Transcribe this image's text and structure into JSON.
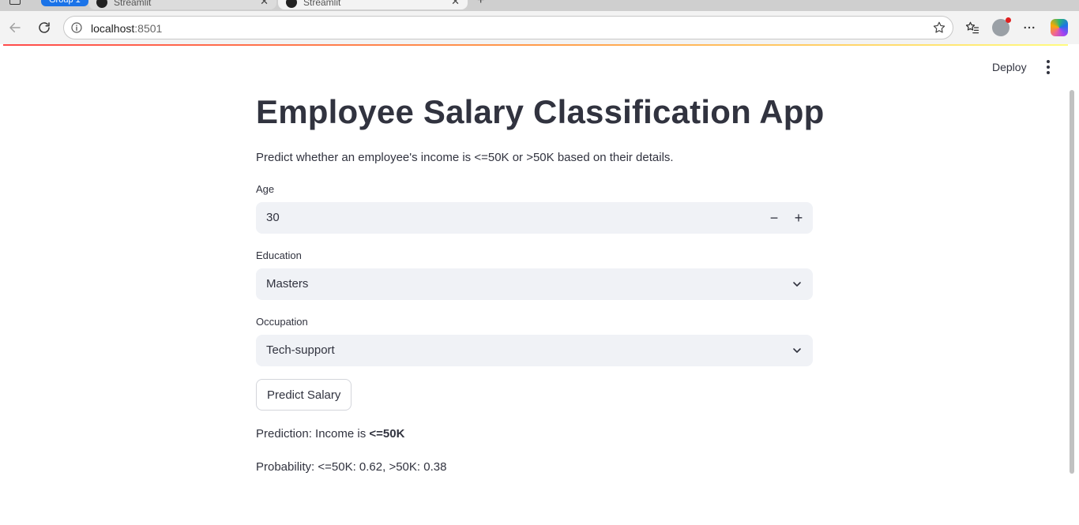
{
  "browser": {
    "tab_group_label": "Group 1",
    "tabs": [
      {
        "title": "Streamlit"
      },
      {
        "title": "Streamlit"
      }
    ],
    "url_host": "localhost",
    "url_port": ":8501"
  },
  "header": {
    "deploy_label": "Deploy"
  },
  "app": {
    "title": "Employee Salary Classification App",
    "subtitle": "Predict whether an employee's income is <=50K or >50K based on their details.",
    "age": {
      "label": "Age",
      "value": "30",
      "decrement": "−",
      "increment": "+"
    },
    "education": {
      "label": "Education",
      "value": "Masters"
    },
    "occupation": {
      "label": "Occupation",
      "value": "Tech-support"
    },
    "predict_button": "Predict Salary",
    "prediction_prefix": "Prediction: Income is ",
    "prediction_value": "<=50K",
    "probability_text": "Probability: <=50K: 0.62, >50K: 0.38"
  },
  "colors": {
    "accent": "#ff4b4b",
    "input_bg": "#f0f2f6",
    "text": "#31333f"
  }
}
